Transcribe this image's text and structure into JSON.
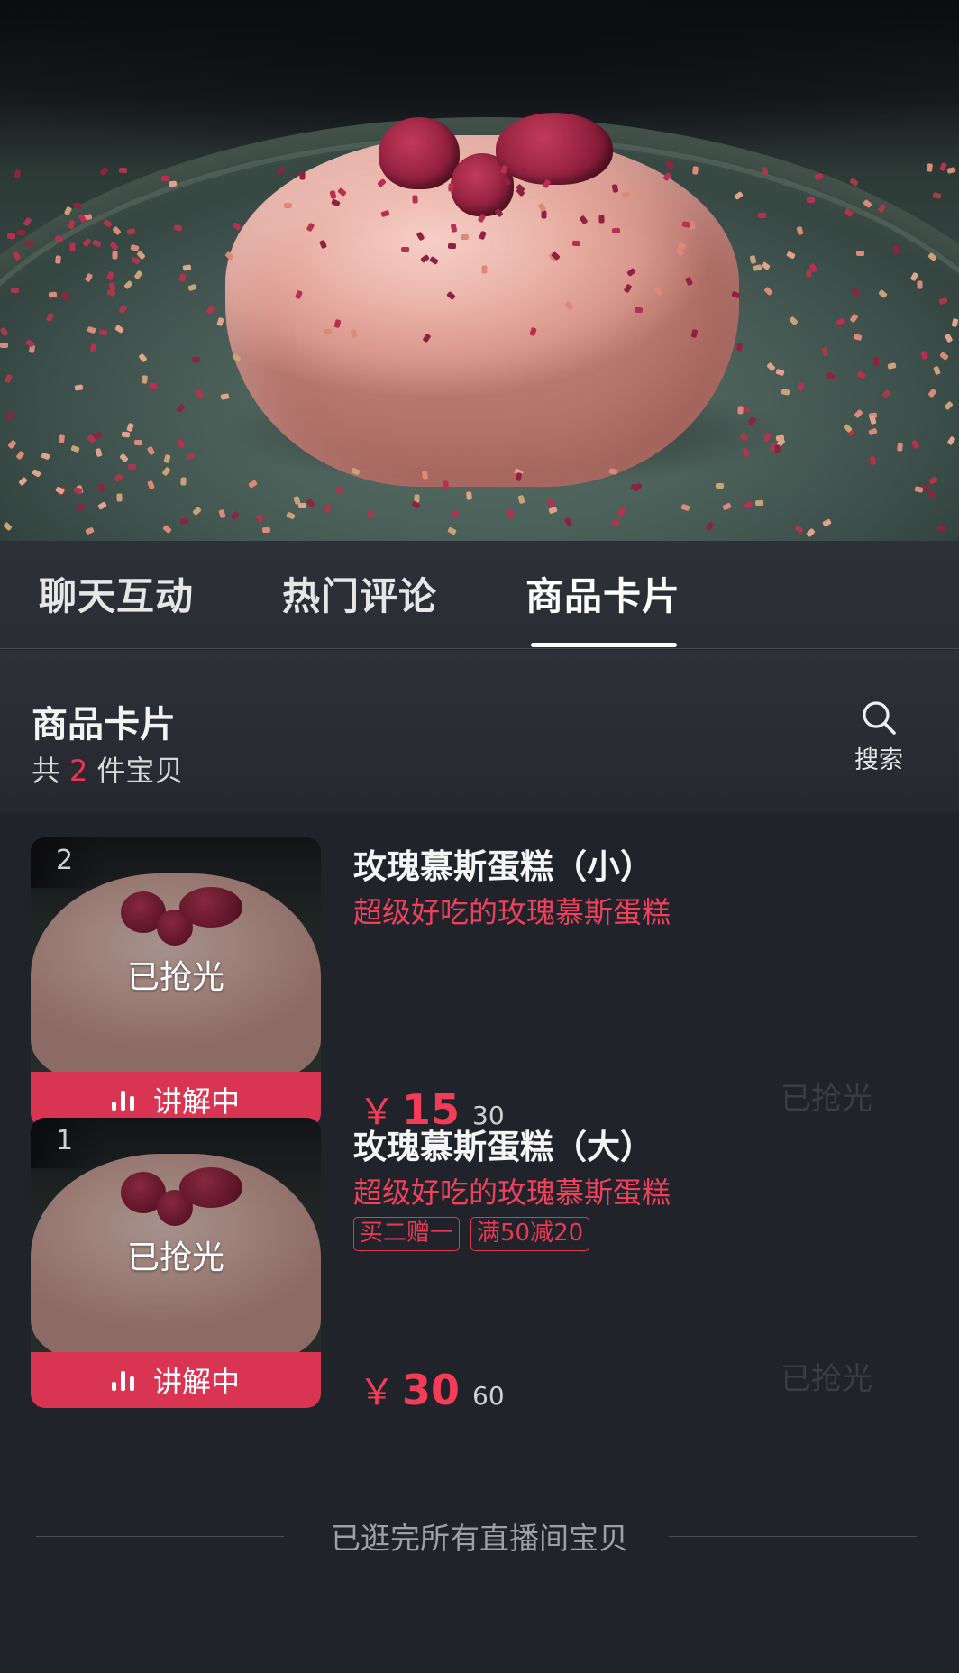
{
  "tabs": [
    {
      "label": "聊天互动",
      "active": false
    },
    {
      "label": "热门评论",
      "active": false
    },
    {
      "label": "商品卡片",
      "active": true
    }
  ],
  "section": {
    "title": "商品卡片",
    "count_prefix": "共",
    "count": "2",
    "count_suffix": "件宝贝",
    "search_label": "搜索"
  },
  "products": [
    {
      "index": "2",
      "sold_out_label": "已抢光",
      "explaining_label": "讲解中",
      "title": "玫瑰慕斯蛋糕（小）",
      "subtitle": "超级好吃的玫瑰慕斯蛋糕",
      "tags": [],
      "currency": "￥",
      "price": "15",
      "original_price": "30",
      "status": "已抢光"
    },
    {
      "index": "1",
      "sold_out_label": "已抢光",
      "explaining_label": "讲解中",
      "title": "玫瑰慕斯蛋糕（大）",
      "subtitle": "超级好吃的玫瑰慕斯蛋糕",
      "tags": [
        "买二赠一",
        "满50减20"
      ],
      "currency": "￥",
      "price": "30",
      "original_price": "60",
      "status": "已抢光"
    }
  ],
  "footer": {
    "end_text": "已逛完所有直播间宝贝"
  },
  "colors": {
    "accent": "#f0314f",
    "explaining_bar": "#d93452",
    "background": "#20232a"
  },
  "icons": [
    "search-icon",
    "bar-chart-icon"
  ]
}
